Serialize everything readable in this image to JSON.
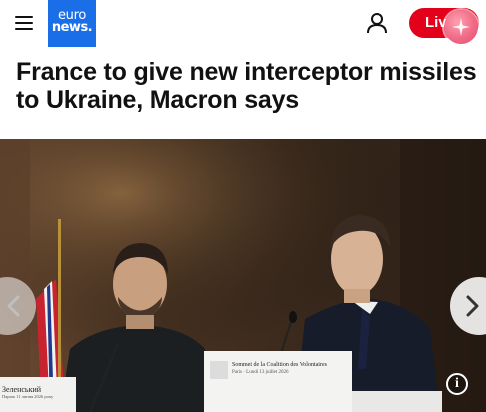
{
  "header": {
    "menu_icon": "hamburger-menu-icon",
    "logo": {
      "line1": "euro",
      "line2": "news."
    },
    "account_icon": "user-icon",
    "live_label": "Live",
    "brand_color": "#1a6fe8",
    "live_color": "#e3001b"
  },
  "article": {
    "headline": "France to give new interceptor missiles to Ukraine, Macron says"
  },
  "photo": {
    "prev_icon": "chevron-left-icon",
    "next_icon": "chevron-right-icon",
    "info_icon": "info-icon",
    "info_label": "i",
    "sign_left": {
      "name": "Зеленський",
      "subtitle": "Париж 11 липня 2026 року"
    },
    "sign_right": {
      "title": "Sommet de la Coalition des Volontaires",
      "subtitle": "Paris · Lundi 13 juillet 2026"
    }
  }
}
